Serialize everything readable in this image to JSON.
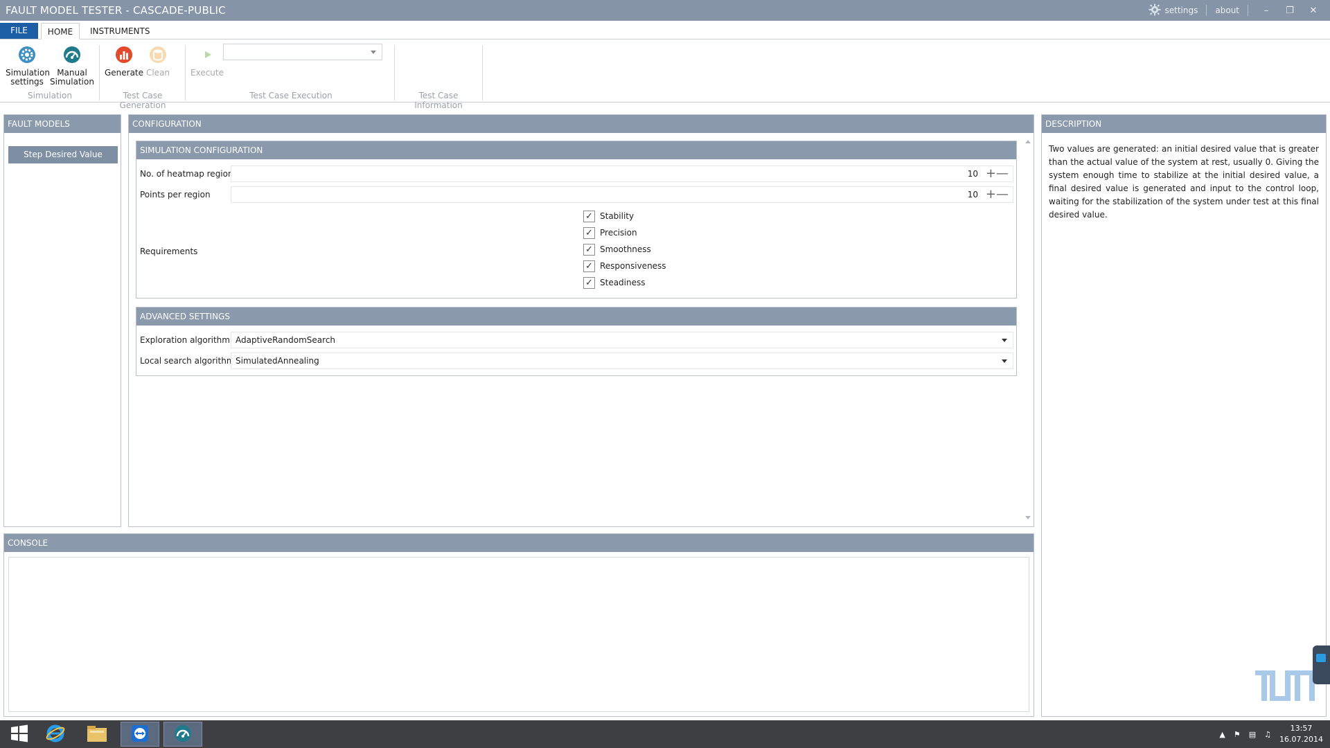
{
  "window": {
    "title": "FAULT MODEL TESTER - CASCADE-PUBLIC",
    "settings_label": "settings",
    "about_label": "about"
  },
  "ribbon": {
    "tabs": [
      {
        "label": "FILE"
      },
      {
        "label": "HOME"
      },
      {
        "label": "INSTRUMENTS"
      }
    ],
    "buttons": {
      "simulation_settings": "Simulation\nsettings",
      "manual_simulation": "Manual\nSimulation",
      "generate": "Generate",
      "clean": "Clean",
      "execute": "Execute"
    },
    "groups": {
      "simulation": "Simulation",
      "test_case_generation": "Test Case Generation",
      "test_case_execution": "Test Case Execution",
      "test_case_information": "Test Case Information"
    },
    "execute_combo_value": ""
  },
  "fault_models": {
    "header": "FAULT MODELS",
    "items": [
      "Step Desired Value"
    ]
  },
  "configuration": {
    "header": "CONFIGURATION",
    "simulation_configuration": {
      "header": "SIMULATION CONFIGURATION",
      "heatmap_regions_label": "No. of heatmap regions",
      "heatmap_regions_value": "10",
      "points_per_region_label": "Points per region",
      "points_per_region_value": "10",
      "requirements_label": "Requirements",
      "requirements": [
        {
          "label": "Stability",
          "checked": true
        },
        {
          "label": "Precision",
          "checked": true
        },
        {
          "label": "Smoothness",
          "checked": true
        },
        {
          "label": "Responsiveness",
          "checked": true
        },
        {
          "label": "Steadiness",
          "checked": true
        }
      ]
    },
    "advanced_settings": {
      "header": "ADVANCED SETTINGS",
      "exploration_label": "Exploration algorithm",
      "exploration_value": "AdaptiveRandomSearch",
      "local_search_label": "Local search algorithm",
      "local_search_value": "SimulatedAnnealing"
    }
  },
  "description": {
    "header": "DESCRIPTION",
    "text": "Two values are generated: an initial desired value that is greater than the actual value of the system at rest, usually 0. Giving the system enough time to stabilize at the initial desired value, a final desired value is generated and input to the control loop, waiting for the stabilization of the system under test at this final desired value."
  },
  "console": {
    "header": "CONSOLE"
  },
  "taskbar": {
    "time": "13:57",
    "date": "16.07.2014"
  },
  "colors": {
    "title_bar": "#8595a7",
    "panel_header": "#8a99ab",
    "file_tab": "#1b5ea6",
    "selected_item": "#7e8fa3",
    "taskbar": "#3d3f43"
  }
}
